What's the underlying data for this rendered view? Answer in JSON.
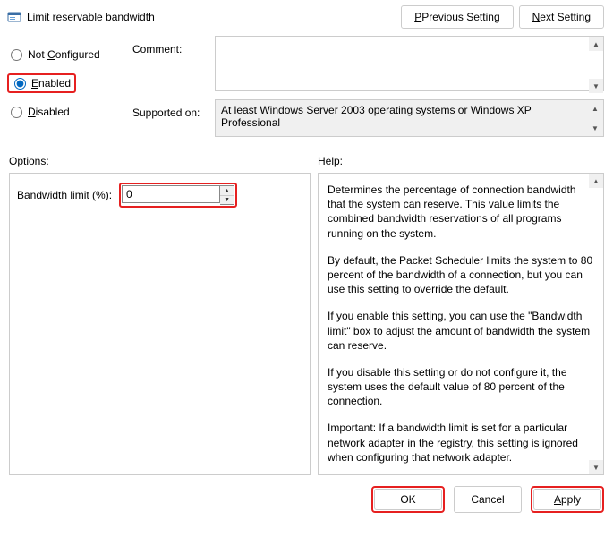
{
  "header": {
    "title": "Limit reservable bandwidth",
    "prev_label": "Previous Setting",
    "prev_underline": "P",
    "next_label": "ext Setting",
    "next_underline": "N"
  },
  "state": {
    "not_configured_label": "Not Configured",
    "not_configured_u": "C",
    "enabled_label": "nabled",
    "enabled_u": "E",
    "disabled_label": "isabled",
    "disabled_u": "D",
    "selected": "enabled"
  },
  "fields": {
    "comment_label": "Comment:",
    "comment_value": "",
    "supported_label": "Supported on:",
    "supported_value": "At least Windows Server 2003 operating systems or Windows XP Professional"
  },
  "sections": {
    "options_label": "Options:",
    "help_label": "Help:"
  },
  "options": {
    "bandwidth_label": "Bandwidth limit (%):",
    "bandwidth_value": "0"
  },
  "help": {
    "p1": "Determines the percentage of connection bandwidth that the system can reserve. This value limits the combined bandwidth reservations of all programs running on the system.",
    "p2": "By default, the Packet Scheduler limits the system to 80 percent of the bandwidth of a connection, but you can use this setting to override the default.",
    "p3": "If you enable this setting, you can use the \"Bandwidth limit\" box to adjust the amount of bandwidth the system can reserve.",
    "p4": "If you disable this setting or do not configure it, the system uses the default value of 80 percent of the connection.",
    "p5": "Important: If a bandwidth limit is set for a particular network adapter in the registry, this setting is ignored when configuring that network adapter."
  },
  "footer": {
    "ok": "OK",
    "cancel": "Cancel",
    "apply_label": "pply",
    "apply_u": "A"
  }
}
